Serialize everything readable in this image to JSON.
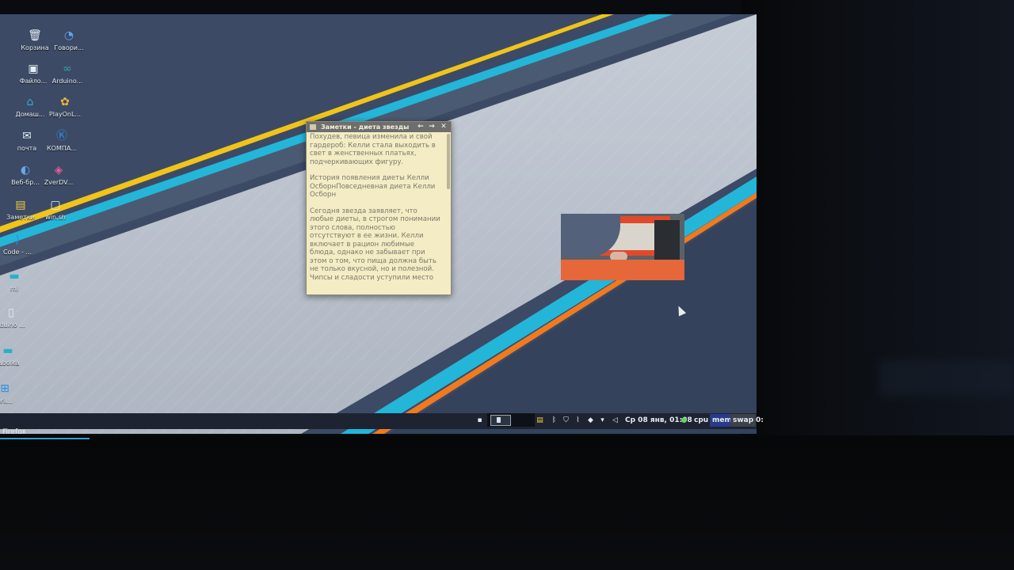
{
  "desktop_icons": [
    {
      "label": "Корзина",
      "icon": "trash-icon",
      "color": "#d9e1ea"
    },
    {
      "label": "Говори...",
      "icon": "speech-app-icon",
      "color": "#5aa8f0"
    },
    {
      "label": "Файло...",
      "icon": "file-manager-icon",
      "color": "#d9e1ea"
    },
    {
      "label": "Arduino...",
      "icon": "arduino-icon",
      "color": "#2aa7a7"
    },
    {
      "label": "Домаш...",
      "icon": "home-folder-icon",
      "color": "#2ab0c8"
    },
    {
      "label": "PlayOnL...",
      "icon": "playonlinux-icon",
      "color": "#f2b33a"
    },
    {
      "label": "почта",
      "icon": "mail-icon",
      "color": "#d9e1ea"
    },
    {
      "label": "КОМПА...",
      "icon": "kompas-icon",
      "color": "#2b8fe0"
    },
    {
      "label": "Веб-бр...",
      "icon": "web-browser-icon",
      "color": "#6aa6ee"
    },
    {
      "label": "ZverDV...",
      "icon": "document-app-icon",
      "color": "#e65a9a"
    },
    {
      "label": "Заметки",
      "icon": "notes-icon",
      "color": "#f2cf3a"
    },
    {
      "label": "win.sh",
      "icon": "script-file-icon",
      "color": "#d9e1ea"
    },
    {
      "label": "Code - ...",
      "icon": "vscode-icon",
      "color": "#2b8fe0"
    },
    {
      "label": "mj",
      "icon": "folder-icon",
      "color": "#2ab0c8"
    },
    {
      "label": "rduino ...",
      "icon": "file-icon",
      "color": "#d9e1ea"
    },
    {
      "label": "labolka",
      "icon": "folder-icon",
      "color": "#2ab0c8"
    },
    {
      "label": "oril...",
      "icon": "windows-icon",
      "color": "#2b8fe0"
    }
  ],
  "notes_window": {
    "title": "Заметки - диета звезды",
    "paragraphs": [
      "Похудев, певица изменила и свой гардероб: Келли стала выходить в свет в женственных платьях, подчеркивающих фигуру.",
      "История появления диеты Келли ОсборнПовседневная диета Келли Осборн",
      "Сегодня звезда заявляет, что любые диеты, в строгом понимании этого слова, полностью отсутствуют в ее жизни. Келли включает в рацион любимые блюда, однако не забывает при этом о том, что пища должна быть не только вкусной, но и полезной. Чипсы и сладости уступили место"
    ]
  },
  "taskbar": {
    "active_task": "Firefox",
    "clock": "Ср 08 янв, 01:08",
    "monitors": {
      "cpu": "cpu",
      "mem": "mem",
      "swap": "swap"
    },
    "overflow": "0:"
  }
}
